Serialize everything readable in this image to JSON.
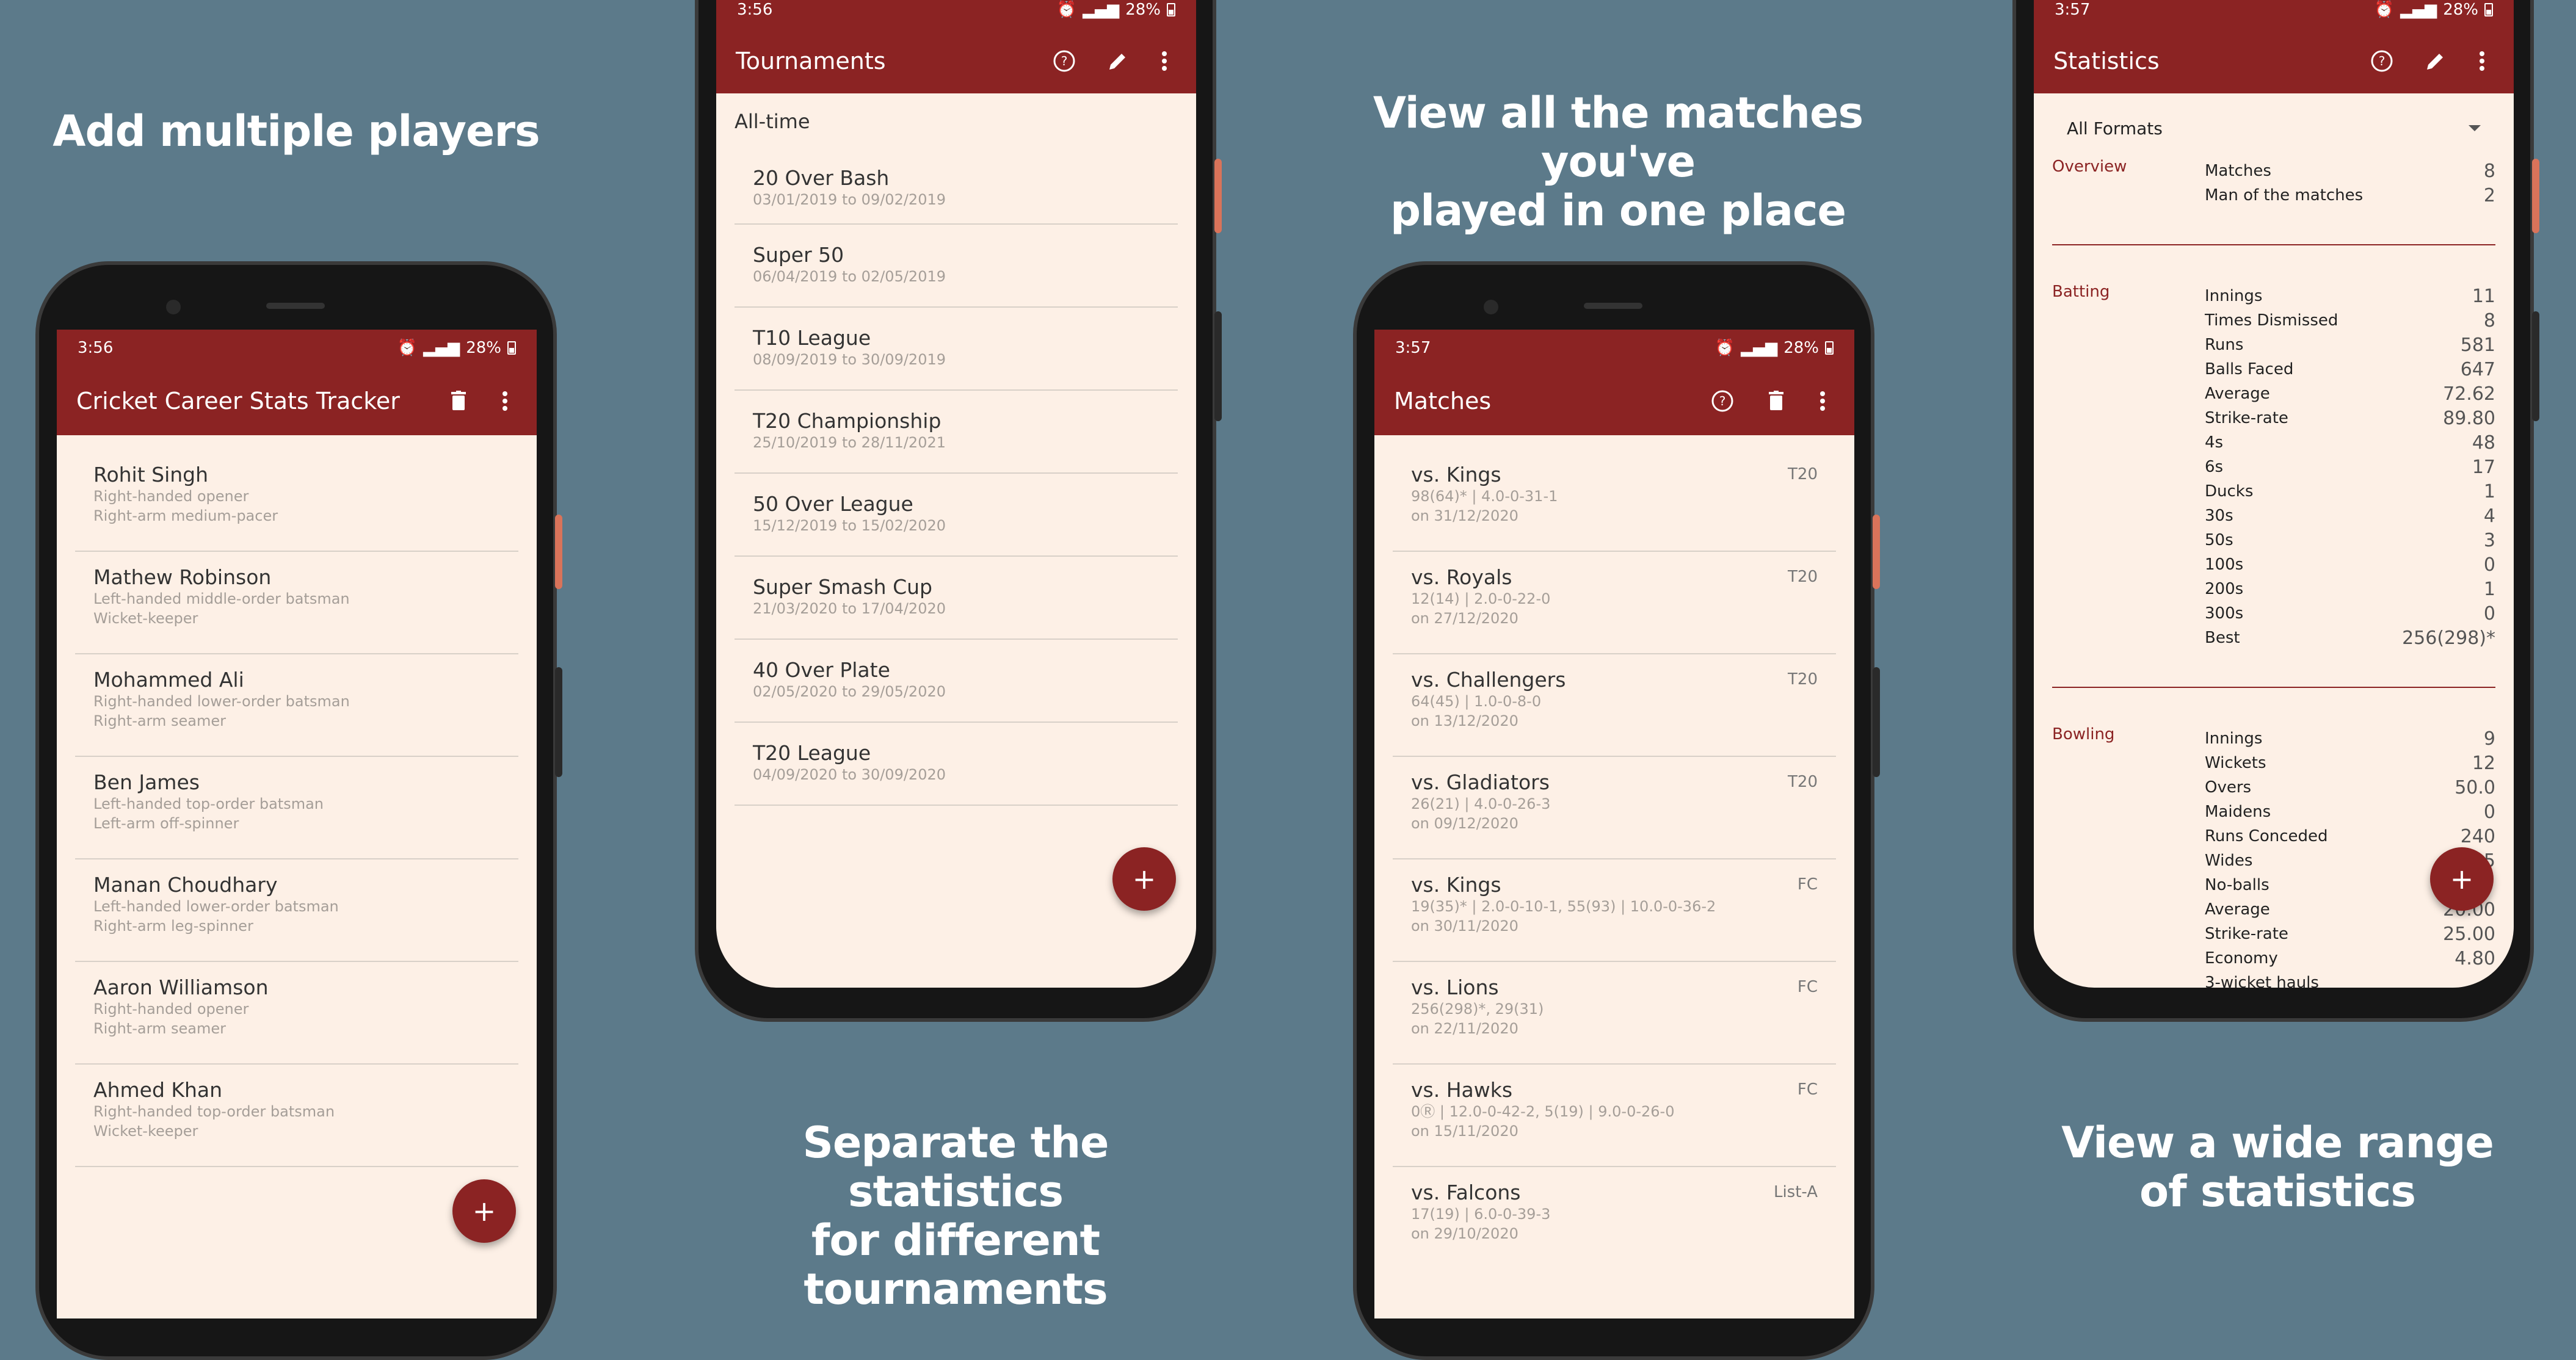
{
  "captions": {
    "c1": [
      "Add multiple players"
    ],
    "c2": [
      "Separate the statistics",
      "for different tournaments"
    ],
    "c3": [
      "View all the matches you've",
      "played in one place"
    ],
    "c4": [
      "View a wide range",
      "of statistics"
    ]
  },
  "phone1": {
    "time": "3:56",
    "battery": "28%",
    "title": "Cricket Career Stats Tracker",
    "players": [
      {
        "name": "Rohit Singh",
        "l1": "Right-handed opener",
        "l2": "Right-arm medium-pacer"
      },
      {
        "name": "Mathew Robinson",
        "l1": "Left-handed middle-order batsman",
        "l2": "Wicket-keeper"
      },
      {
        "name": "Mohammed Ali",
        "l1": "Right-handed lower-order batsman",
        "l2": "Right-arm seamer"
      },
      {
        "name": "Ben James",
        "l1": "Left-handed top-order batsman",
        "l2": "Left-arm off-spinner"
      },
      {
        "name": "Manan Choudhary",
        "l1": "Left-handed lower-order batsman",
        "l2": "Right-arm leg-spinner"
      },
      {
        "name": "Aaron Williamson",
        "l1": "Right-handed opener",
        "l2": "Right-arm seamer"
      },
      {
        "name": "Ahmed Khan",
        "l1": "Right-handed top-order batsman",
        "l2": "Wicket-keeper"
      }
    ]
  },
  "phone2": {
    "time": "3:56",
    "battery": "28%",
    "title": "Tournaments",
    "filter": "All-time",
    "tournaments": [
      {
        "name": "20 Over Bash",
        "dates": "03/01/2019 to 09/02/2019"
      },
      {
        "name": "Super 50",
        "dates": "06/04/2019 to 02/05/2019"
      },
      {
        "name": "T10 League",
        "dates": "08/09/2019 to 30/09/2019"
      },
      {
        "name": "T20 Championship",
        "dates": "25/10/2019 to 28/11/2021"
      },
      {
        "name": "50 Over League",
        "dates": "15/12/2019 to 15/02/2020"
      },
      {
        "name": "Super Smash Cup",
        "dates": "21/03/2020 to 17/04/2020"
      },
      {
        "name": "40 Over Plate",
        "dates": "02/05/2020 to 29/05/2020"
      },
      {
        "name": "T20 League",
        "dates": "04/09/2020 to 30/09/2020"
      }
    ]
  },
  "phone3": {
    "time": "3:57",
    "battery": "28%",
    "title": "Matches",
    "matches": [
      {
        "opp": "vs. Kings",
        "score": "98(64)* | 4.0-0-31-1",
        "date": "on 31/12/2020",
        "format": "T20"
      },
      {
        "opp": "vs. Royals",
        "score": "12(14) | 2.0-0-22-0",
        "date": "on 27/12/2020",
        "format": "T20"
      },
      {
        "opp": "vs. Challengers",
        "score": "64(45) | 1.0-0-8-0",
        "date": "on 13/12/2020",
        "format": "T20"
      },
      {
        "opp": "vs. Gladiators",
        "score": "26(21) | 4.0-0-26-3",
        "date": "on 09/12/2020",
        "format": "T20"
      },
      {
        "opp": "vs. Kings",
        "score": "19(35)* | 2.0-0-10-1, 55(93) | 10.0-0-36-2",
        "date": "on 30/11/2020",
        "format": "FC"
      },
      {
        "opp": "vs. Lions",
        "score": "256(298)*, 29(31)",
        "date": "on 22/11/2020",
        "format": "FC"
      },
      {
        "opp": "vs. Hawks",
        "score": "0Ⓡ | 12.0-0-42-2, 5(19) | 9.0-0-26-0",
        "date": "on 15/11/2020",
        "format": "FC"
      },
      {
        "opp": "vs. Falcons",
        "score": "17(19) | 6.0-0-39-3",
        "date": "on 29/10/2020",
        "format": "List-A"
      }
    ]
  },
  "phone4": {
    "time": "3:57",
    "battery": "28%",
    "title": "Statistics",
    "format_select": "All Formats",
    "overview": {
      "heading": "Overview",
      "rows": [
        [
          "Matches",
          "8"
        ],
        [
          "Man of the matches",
          "2"
        ]
      ]
    },
    "batting": {
      "heading": "Batting",
      "rows": [
        [
          "Innings",
          "11"
        ],
        [
          "Times Dismissed",
          "8"
        ],
        [
          "Runs",
          "581"
        ],
        [
          "Balls Faced",
          "647"
        ],
        [
          "Average",
          "72.62"
        ],
        [
          "Strike-rate",
          "89.80"
        ],
        [
          "4s",
          "48"
        ],
        [
          "6s",
          "17"
        ],
        [
          "Ducks",
          "1"
        ],
        [
          "30s",
          "4"
        ],
        [
          "50s",
          "3"
        ],
        [
          "100s",
          "0"
        ],
        [
          "200s",
          "1"
        ],
        [
          "300s",
          "0"
        ],
        [
          "Best",
          "256(298)*"
        ]
      ]
    },
    "bowling": {
      "heading": "Bowling",
      "rows": [
        [
          "Innings",
          "9"
        ],
        [
          "Wickets",
          "12"
        ],
        [
          "Overs",
          "50.0"
        ],
        [
          "Maidens",
          "0"
        ],
        [
          "Runs Conceded",
          "240"
        ],
        [
          "Wides",
          "5"
        ],
        [
          "No-balls",
          ""
        ],
        [
          "Average",
          "20.00"
        ],
        [
          "Strike-rate",
          "25.00"
        ],
        [
          "Economy",
          "4.80"
        ],
        [
          "3-wicket hauls",
          ""
        ]
      ]
    }
  }
}
